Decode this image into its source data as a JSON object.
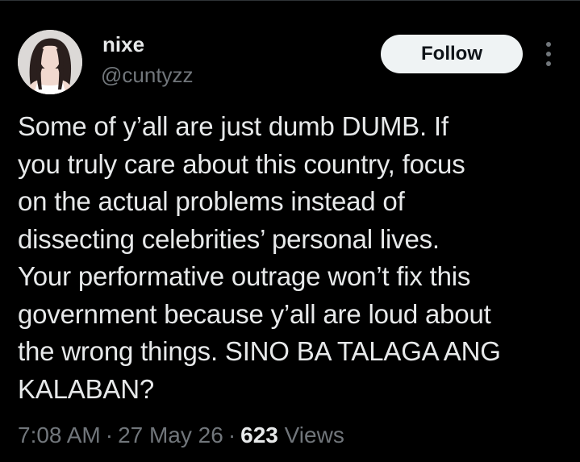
{
  "tweet": {
    "author": {
      "display_name": "nixe",
      "handle": "@cuntyzz"
    },
    "follow_label": "Follow",
    "text": "Some of y’all are just dumb DUMB. If\nyou truly care about this country, focus\non the actual problems instead of\ndissecting celebrities’ personal lives.\nYour performative outrage won’t fix this\ngovernment because y’all are loud about\nthe wrong things. SINO BA TALAGA ANG\nKALABAN?",
    "time": "7:08 AM",
    "separator": "·",
    "date": "27 May 26",
    "views_count": "623",
    "views_label": "Views"
  },
  "colors": {
    "background": "#000000",
    "primary_text": "#e7e9ea",
    "secondary_text": "#71767b",
    "follow_button_bg": "#eff3f4",
    "follow_button_text": "#0f1419"
  },
  "icons": {
    "more": "more-vertical-icon",
    "avatar": "avatar"
  }
}
